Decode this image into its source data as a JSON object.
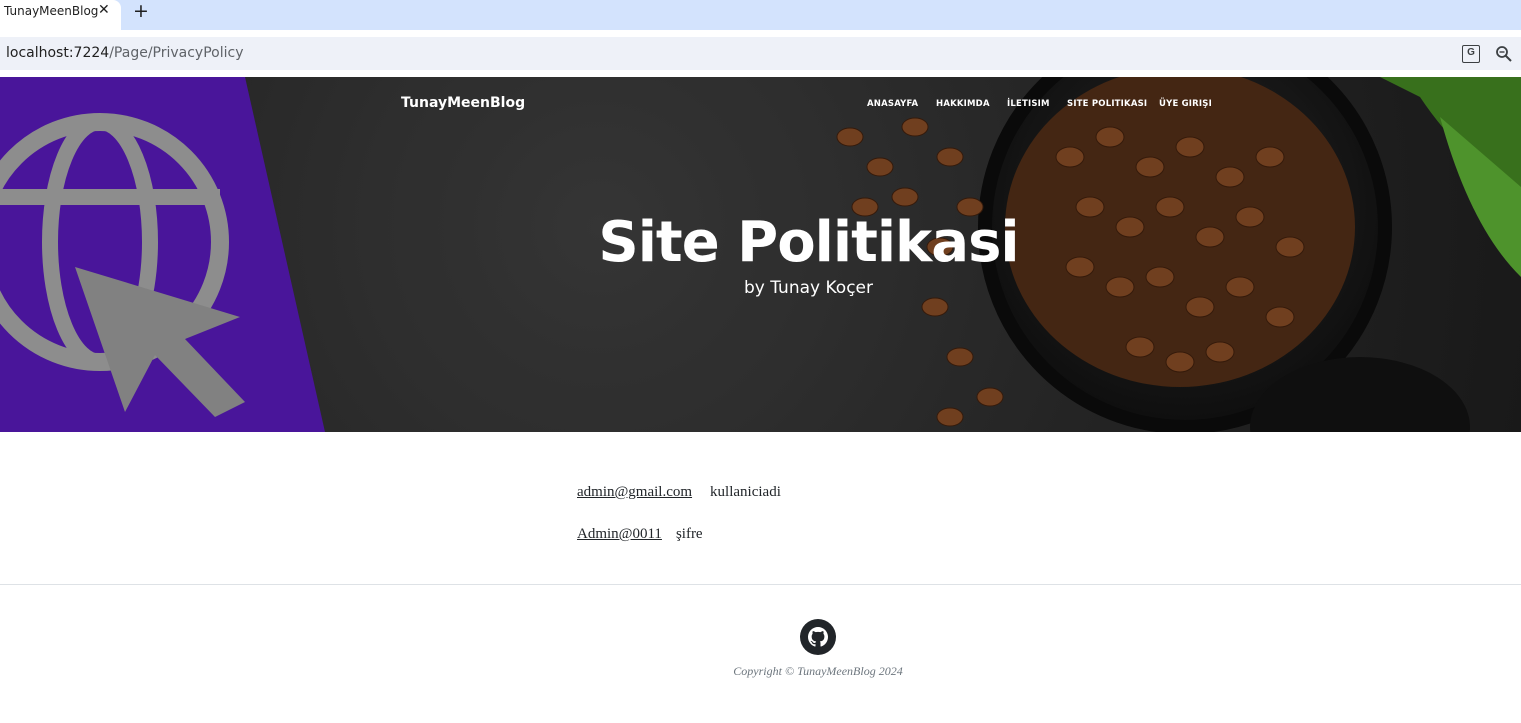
{
  "browser": {
    "tab_title": "TunayMeenBlog",
    "tab_close": "✕",
    "new_tab": "+",
    "url_domain": "localhost:7224",
    "url_path": "/Page/PrivacyPolicy",
    "translate_icon": "translate-icon",
    "zoom_icon": "zoom-icon"
  },
  "header": {
    "brand": "TunayMeenBlog",
    "nav": [
      "ANASAYFA",
      "HAKKIMDA",
      "İLETISIM",
      "SITE POLITIKASI",
      "ÜYE GIRIŞI"
    ],
    "title": "Site Politikasi",
    "subtitle": "by Tunay Koçer",
    "accent_color": "#5017a8"
  },
  "content": {
    "rows": [
      {
        "link": "admin@gmail.com",
        "value": "kullaniciadi"
      },
      {
        "link": "Admin@0011",
        "value": "şifre"
      }
    ]
  },
  "footer": {
    "social_icon": "github-icon",
    "copyright": "Copyright © TunayMeenBlog 2024"
  }
}
